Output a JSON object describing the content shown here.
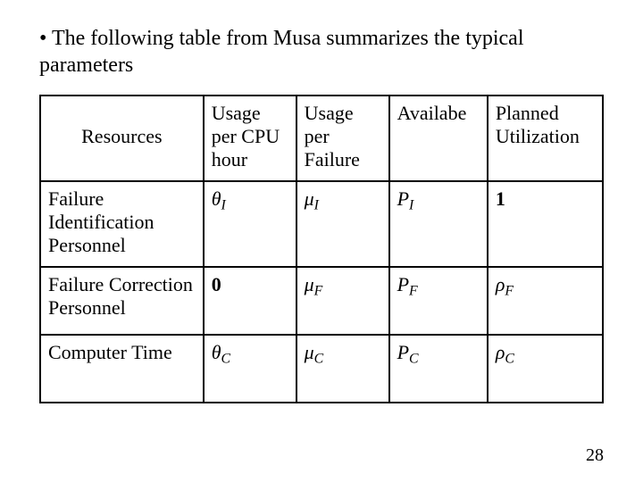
{
  "bullet_prefix": "• ",
  "bullet_text": "The following table from Musa summarizes the typical parameters",
  "headers": {
    "corner": "Resources",
    "c1": "Usage per CPU hour",
    "c2": "Usage per Failure",
    "c3": "Availabe",
    "c4": "Planned Utilization"
  },
  "rows": [
    {
      "label": "Failure Identification Personnel",
      "c1": {
        "base": "θ",
        "sub": "I"
      },
      "c2": {
        "base": "μ",
        "sub": "I"
      },
      "c3": {
        "base": "P",
        "sub": "I"
      },
      "c4": {
        "literal": "1"
      }
    },
    {
      "label": "Failure Correction Personnel",
      "c1": {
        "literal": "0"
      },
      "c2": {
        "base": "μ",
        "sub": "F"
      },
      "c3": {
        "base": "P",
        "sub": "F"
      },
      "c4": {
        "base": "ρ",
        "sub": "F"
      }
    },
    {
      "label": "Computer Time",
      "c1": {
        "base": "θ",
        "sub": "C"
      },
      "c2": {
        "base": "μ",
        "sub": "C"
      },
      "c3": {
        "base": "P",
        "sub": "C"
      },
      "c4": {
        "base": "ρ",
        "sub": "C"
      }
    }
  ],
  "page_number": "28"
}
